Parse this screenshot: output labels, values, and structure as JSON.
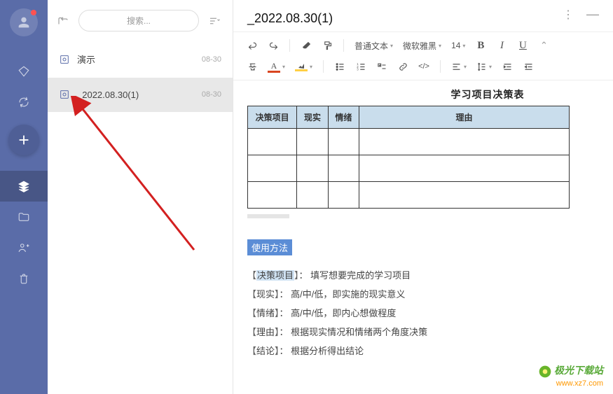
{
  "sidebar": {
    "icons": [
      "diamond",
      "sync",
      "add",
      "stack",
      "folder",
      "share",
      "trash"
    ]
  },
  "list": {
    "search_placeholder": "搜索...",
    "items": [
      {
        "icon": "present",
        "title": "演示",
        "date": "08-30"
      },
      {
        "icon": "present",
        "title": "_2022.08.30(1)",
        "date": "08-30"
      }
    ]
  },
  "editor": {
    "title": "_2022.08.30(1)",
    "toolbar": {
      "text_style": "普通文本",
      "font_family": "微软雅黑",
      "font_size": "14",
      "bold": "B",
      "italic": "I",
      "underline": "U",
      "font_color_letter": "A",
      "highlight_letter": "A"
    },
    "content_title_partial": "学习项目决策表",
    "table": {
      "headers": [
        "决策项目",
        "现实",
        "情绪",
        "理由"
      ]
    },
    "usage": {
      "title": "使用方法",
      "lines": [
        {
          "label": "决策项目",
          "text": "： 填写想要完成的学习项目",
          "highlight": true
        },
        {
          "label": "现实",
          "text": "： 高/中/低，即实施的现实意义"
        },
        {
          "label": "情绪",
          "text": "： 高/中/低，即内心想做程度"
        },
        {
          "label": "理由",
          "text": "： 根据现实情况和情绪两个角度决策"
        },
        {
          "label": "结论",
          "text": "： 根据分析得出结论"
        }
      ]
    }
  },
  "watermark": {
    "line1": "极光下载站",
    "line2": "www.xz7.com"
  }
}
